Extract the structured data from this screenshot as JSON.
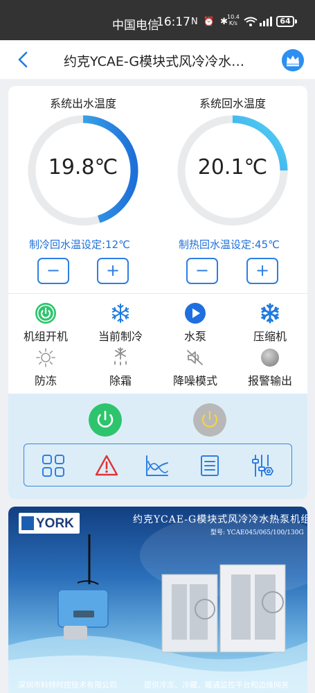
{
  "status_bar": {
    "carrier": "中国电信",
    "time": "16:17",
    "icons": "N ⏰ ✱",
    "speed_value": "10.4",
    "speed_unit": "K/s",
    "battery": "64"
  },
  "header": {
    "title": "约克YCAE-G模块式风冷冷水…",
    "back_icon": "chevron-left-icon",
    "vip_icon": "crown-icon"
  },
  "gauges": [
    {
      "label": "系统出水温度",
      "value": "19.8℃",
      "fill": 0.45,
      "setpoint": "制冷回水温设定:12℃"
    },
    {
      "label": "系统回水温度",
      "value": "20.1℃",
      "fill": 0.25,
      "setpoint": "制热回水温设定:45℃"
    }
  ],
  "stepper": {
    "minus": "−",
    "plus": "+"
  },
  "status_items": [
    {
      "label": "机组开机",
      "icon": "power-on-icon",
      "state": "on"
    },
    {
      "label": "当前制冷",
      "icon": "snowflake-icon",
      "state": "on"
    },
    {
      "label": "水泵",
      "icon": "play-icon",
      "state": "on"
    },
    {
      "label": "压缩机",
      "icon": "snowflake-icon",
      "state": "on"
    },
    {
      "label": "防冻",
      "icon": "sun-icon",
      "state": "off"
    },
    {
      "label": "除霜",
      "icon": "defrost-icon",
      "state": "off"
    },
    {
      "label": "降噪模式",
      "icon": "mute-icon",
      "state": "off"
    },
    {
      "label": "报警输出",
      "icon": "dot-icon",
      "state": "off"
    }
  ],
  "controls": {
    "power_on": {
      "icon": "power-icon",
      "color": "#2ec46d"
    },
    "power_off": {
      "icon": "power-icon",
      "color": "#b8b8b8"
    }
  },
  "toolbar": [
    {
      "icon": "grid-icon"
    },
    {
      "icon": "alarm-icon"
    },
    {
      "icon": "chart-icon"
    },
    {
      "icon": "list-icon"
    },
    {
      "icon": "settings-icon"
    }
  ],
  "banner": {
    "brand": "YORK",
    "title": "约克YCAE-G模块式风冷冷水热泵机组",
    "model": "型号: YCAE045/065/100/130G",
    "footer_left": "深圳市科特时控技术有限公司",
    "footer_right": "提供冷冻、冷藏、暖通监控平台和边缘网关"
  },
  "colors": {
    "accent": "#2d7ee0",
    "gauge_arc": "#2aa4e8",
    "gauge_track": "#e9eaec",
    "power_on": "#2ec46d",
    "alarm": "#e03333"
  }
}
